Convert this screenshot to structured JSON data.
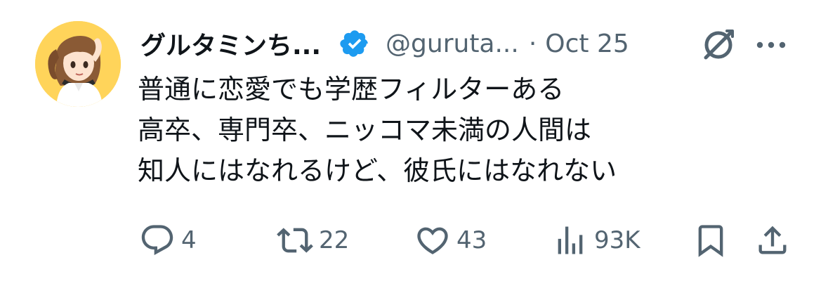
{
  "tweet": {
    "author": {
      "display_name": "グルタミンち...",
      "handle": "@guruta...",
      "verified": true
    },
    "separator": "·",
    "date": "Oct 25",
    "lines": [
      "普通に恋愛でも学歴フィルターある",
      "高卒、専門卒、ニッコマ未満の人間は",
      "知人にはなれるけど、彼氏にはなれない"
    ],
    "actions": {
      "replies": "4",
      "retweets": "22",
      "likes": "43",
      "views": "93K"
    },
    "icons": {
      "verified": "verified-badge-icon",
      "grok": "grok-icon",
      "more": "more-icon",
      "reply": "reply-icon",
      "retweet": "retweet-icon",
      "like": "heart-icon",
      "views": "views-icon",
      "bookmark": "bookmark-icon",
      "share": "share-icon"
    },
    "colors": {
      "text": "#0f1419",
      "secondary": "#536471",
      "verified": "#1d9bf0"
    }
  }
}
